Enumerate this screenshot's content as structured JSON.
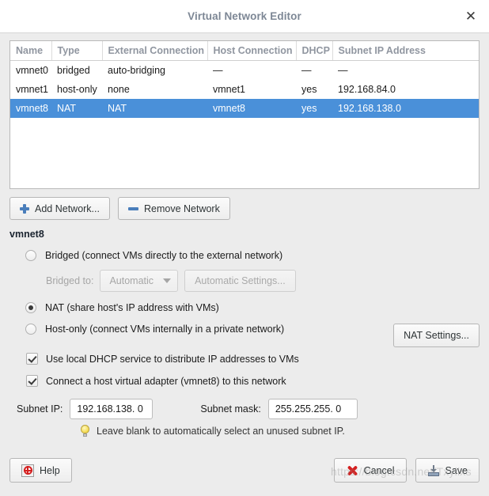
{
  "window": {
    "title": "Virtual Network Editor",
    "close_icon": "close-icon"
  },
  "network_table": {
    "columns": [
      "Name",
      "Type",
      "External Connection",
      "Host Connection",
      "DHCP",
      "Subnet IP Address"
    ],
    "rows": [
      {
        "name": "vmnet0",
        "type": "bridged",
        "external_connection": "auto-bridging",
        "host_connection": "—",
        "dhcp": "—",
        "subnet_ip": "—",
        "selected": false
      },
      {
        "name": "vmnet1",
        "type": "host-only",
        "external_connection": "none",
        "host_connection": "vmnet1",
        "dhcp": "yes",
        "subnet_ip": "192.168.84.0",
        "selected": false
      },
      {
        "name": "vmnet8",
        "type": "NAT",
        "external_connection": "NAT",
        "host_connection": "vmnet8",
        "dhcp": "yes",
        "subnet_ip": "192.168.138.0",
        "selected": true
      }
    ],
    "selection_color": "#4a90d9"
  },
  "table_buttons": {
    "add_label": "Add Network...",
    "remove_label": "Remove Network",
    "icon_color": "#4a7ebb"
  },
  "details": {
    "section_title": "vmnet8",
    "options": [
      {
        "label": "Bridged (connect VMs directly to the external network)",
        "checked": false
      },
      {
        "label": "NAT (share host's IP address with VMs)",
        "checked": true
      },
      {
        "label": "Host-only (connect VMs internally in a private network)",
        "checked": false
      }
    ],
    "bridged_to_label": "Bridged to:",
    "bridged_to_value": "Automatic",
    "automatic_settings_label": "Automatic Settings...",
    "nat_settings_label": "NAT Settings...",
    "checkboxes": [
      {
        "label": "Use local DHCP service to distribute IP addresses to VMs",
        "checked": true
      },
      {
        "label": "Connect a host virtual adapter (vmnet8) to this network",
        "checked": true
      }
    ],
    "subnet_ip_label": "Subnet IP:",
    "subnet_ip_value": "192.168.138.  0",
    "subnet_mask_label": "Subnet mask:",
    "subnet_mask_value": "255.255.255.  0",
    "hint_text": "Leave blank to automatically select an unused subnet IP.",
    "hint_icon": "lightbulb-icon"
  },
  "footer": {
    "help_label": "Help",
    "cancel_label": "Cancel",
    "save_label": "Save"
  },
  "watermark": {
    "text": "https://blog.csdn.net/Txyllxs"
  }
}
